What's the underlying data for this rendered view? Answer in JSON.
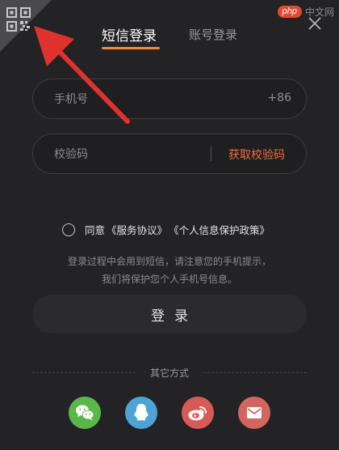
{
  "watermark": {
    "logo": "php",
    "text": "中文网"
  },
  "tabs": [
    {
      "label": "短信登录",
      "active": true
    },
    {
      "label": "账号登录",
      "active": false
    }
  ],
  "phone_field": {
    "placeholder": "手机号",
    "country_code": "+86"
  },
  "code_field": {
    "placeholder": "校验码",
    "get_code_label": "获取校验码"
  },
  "agreement": {
    "agree_label": "同意",
    "service_link": "《服务协议》",
    "privacy_link": "《个人信息保护政策》"
  },
  "hint": {
    "line1": "登录过程中会用到短信，请注意您的手机提示，",
    "line2": "我们将保护您个人手机号信息。"
  },
  "login_button": {
    "label": "登录"
  },
  "other_methods": {
    "label": "其它方式"
  },
  "colors": {
    "background": "#232325",
    "accent": "#f08a3c",
    "link_orange": "#ef6f3a",
    "annotation_arrow": "#e0322c",
    "wechat": "#5ab84a",
    "qq": "#4da3d6",
    "weibo": "#d65a55",
    "mail": "#d2665e"
  },
  "icons": [
    "qr-code-icon",
    "close-icon",
    "wechat-icon",
    "qq-icon",
    "weibo-icon",
    "mail-icon",
    "annotation-arrow"
  ]
}
